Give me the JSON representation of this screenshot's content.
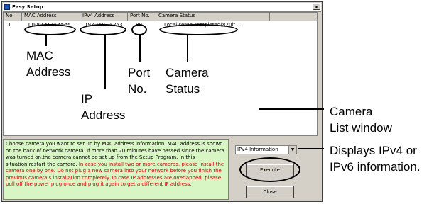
{
  "window": {
    "title": "Easy Setup",
    "close_glyph": "x"
  },
  "list": {
    "columns": [
      "No.",
      "MAC Address",
      "IPv4 Address",
      "Port No.",
      "Camera Status"
    ],
    "rows": [
      {
        "no": "1",
        "mac": "00-80-**-**-**-**",
        "ip": "192.168.  0.253",
        "port": "80",
        "status": "Local setup completed(820lt..."
      }
    ]
  },
  "info": {
    "black_text": "Choose camera you want to set up by MAC address information. MAC address is shown on the back of network camera. If more than 20 minutes have passed since the camera was turned on,the camera cannot be set up from the Setup Program. In this situation,restart the camera.",
    "red_text": "In case you install two or more cameras, please install the camera one by one. Do not plug a new camera into your network before you finish the previous camera's installation completely. In case IP addresses are overlapped, please pull off the power plug once and plug it again to get a different IP address."
  },
  "controls": {
    "ip_select_value": "IPv4 Information",
    "execute_label": "Execute",
    "close_label": "Close"
  },
  "annotations": {
    "mac_1": "MAC",
    "mac_2": "Address",
    "ip_1": "IP",
    "ip_2": "Address",
    "port_1": "Port",
    "port_2": "No.",
    "status_1": "Camera",
    "status_2": "Status",
    "list_1": "Camera",
    "list_2": "List window",
    "disp_1": "Displays IPv4 or",
    "disp_2": "IPv6 information."
  }
}
